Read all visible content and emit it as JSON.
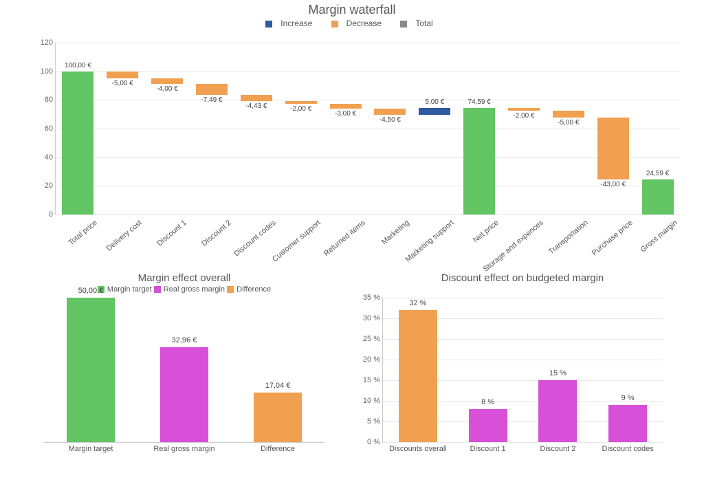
{
  "colors": {
    "total": "#62c462",
    "increase": "#2d5aa0",
    "decrease": "#f0a050",
    "magenta": "#d850d8"
  },
  "chart_data": [
    {
      "type": "waterfall",
      "title": "Margin waterfall",
      "legend": [
        "Increase",
        "Decrease",
        "Total"
      ],
      "ylim": [
        0,
        120
      ],
      "yticks": [
        0,
        20,
        40,
        60,
        80,
        100,
        120
      ],
      "categories": [
        "Total price",
        "Delivery cost",
        "Discount 1",
        "Discount 2",
        "Discount codes",
        "Customer support",
        "Returned items",
        "Marketing",
        "Marketing support",
        "Net price",
        "Storage and expences",
        "Transportation",
        "Purchase price",
        "Gross margin"
      ],
      "items": [
        {
          "label": "100,00 €",
          "kind": "total",
          "from": 0,
          "to": 100
        },
        {
          "label": "-5,00 €",
          "kind": "decrease",
          "from": 100,
          "to": 95
        },
        {
          "label": "-4,00 €",
          "kind": "decrease",
          "from": 95,
          "to": 91
        },
        {
          "label": "-7,49 €",
          "kind": "decrease",
          "from": 91,
          "to": 83.51
        },
        {
          "label": "-4,43 €",
          "kind": "decrease",
          "from": 83.51,
          "to": 79.08
        },
        {
          "label": "-2,00 €",
          "kind": "decrease",
          "from": 79.08,
          "to": 77.08
        },
        {
          "label": "-3,00 €",
          "kind": "decrease",
          "from": 77.08,
          "to": 74.08
        },
        {
          "label": "-4,50 €",
          "kind": "decrease",
          "from": 74.08,
          "to": 69.58
        },
        {
          "label": "5,00 €",
          "kind": "increase",
          "from": 69.58,
          "to": 74.58
        },
        {
          "label": "74,59 €",
          "kind": "total",
          "from": 0,
          "to": 74.59
        },
        {
          "label": "-2,00 €",
          "kind": "decrease",
          "from": 74.59,
          "to": 72.59
        },
        {
          "label": "-5,00 €",
          "kind": "decrease",
          "from": 72.59,
          "to": 67.59
        },
        {
          "label": "-43,00 €",
          "kind": "decrease",
          "from": 67.59,
          "to": 24.59
        },
        {
          "label": "24,59 €",
          "kind": "total",
          "from": 0,
          "to": 24.59
        }
      ]
    },
    {
      "type": "bar",
      "title": "Margin effect overall",
      "legend": [
        "Margin target",
        "Real gross margin",
        "Difference"
      ],
      "ylim": [
        0,
        50
      ],
      "series": [
        {
          "name": "Margin target",
          "value": 50.0,
          "label": "50,00 €",
          "color": "total"
        },
        {
          "name": "Real gross margin",
          "value": 32.96,
          "label": "32,96 €",
          "color": "magenta"
        },
        {
          "name": "Difference",
          "value": 17.04,
          "label": "17,04 €",
          "color": "decrease"
        }
      ]
    },
    {
      "type": "bar",
      "title": "Discount effect on budgeted margin",
      "legend": [],
      "ylim": [
        0,
        35
      ],
      "yticks": [
        0,
        5,
        10,
        15,
        20,
        25,
        30,
        35
      ],
      "ylabel_suffix": " %",
      "series": [
        {
          "name": "Discounts overall",
          "value": 32,
          "label": "32 %",
          "color": "decrease"
        },
        {
          "name": "Discount 1",
          "value": 8,
          "label": "8 %",
          "color": "magenta"
        },
        {
          "name": "Discount 2",
          "value": 15,
          "label": "15 %",
          "color": "magenta"
        },
        {
          "name": "Discount codes",
          "value": 9,
          "label": "9 %",
          "color": "magenta"
        }
      ]
    }
  ]
}
